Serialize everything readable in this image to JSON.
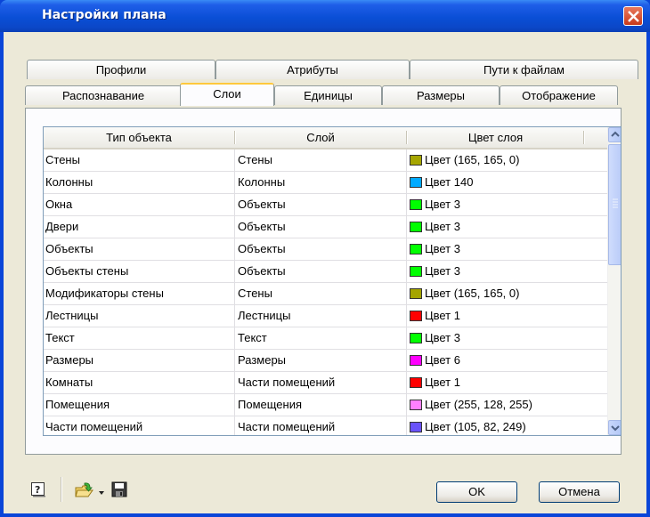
{
  "window": {
    "title": "Настройки плана"
  },
  "tabs_row1": [
    "Профили",
    "Атрибуты",
    "Пути к файлам"
  ],
  "tabs_row2": [
    "Распознавание",
    "Слои",
    "Единицы",
    "Размеры",
    "Отображение"
  ],
  "active_tab": "Слои",
  "table": {
    "headers": [
      "Тип объекта",
      "Слой",
      "Цвет слоя"
    ],
    "rows": [
      {
        "type": "Стены",
        "layer": "Стены",
        "color": "Цвет (165, 165, 0)",
        "swatch": "#a5a500"
      },
      {
        "type": "Колонны",
        "layer": "Колонны",
        "color": "Цвет 140",
        "swatch": "#00aaff"
      },
      {
        "type": "Окна",
        "layer": "Объекты",
        "color": "Цвет 3",
        "swatch": "#00ff00"
      },
      {
        "type": "Двери",
        "layer": "Объекты",
        "color": "Цвет 3",
        "swatch": "#00ff00"
      },
      {
        "type": "Объекты",
        "layer": "Объекты",
        "color": "Цвет 3",
        "swatch": "#00ff00"
      },
      {
        "type": "Объекты стены",
        "layer": "Объекты",
        "color": "Цвет 3",
        "swatch": "#00ff00"
      },
      {
        "type": "Модификаторы стены",
        "layer": "Стены",
        "color": "Цвет (165, 165, 0)",
        "swatch": "#a5a500"
      },
      {
        "type": "Лестницы",
        "layer": "Лестницы",
        "color": "Цвет 1",
        "swatch": "#ff0000"
      },
      {
        "type": "Текст",
        "layer": "Текст",
        "color": "Цвет 3",
        "swatch": "#00ff00"
      },
      {
        "type": "Размеры",
        "layer": "Размеры",
        "color": "Цвет 6",
        "swatch": "#ff00ff"
      },
      {
        "type": "Комнаты",
        "layer": "Части помещений",
        "color": "Цвет 1",
        "swatch": "#ff0000"
      },
      {
        "type": "Помещения",
        "layer": "Помещения",
        "color": "Цвет (255, 128, 255)",
        "swatch": "#ff80ff"
      },
      {
        "type": "Части помещений",
        "layer": "Части помещений",
        "color": "Цвет (105, 82, 249)",
        "swatch": "#6952f9"
      }
    ]
  },
  "buttons": {
    "ok": "OK",
    "cancel": "Отмена"
  },
  "icons": [
    "help-icon",
    "open-folder-icon",
    "dropdown-arrow-icon",
    "save-icon",
    "close-icon"
  ]
}
